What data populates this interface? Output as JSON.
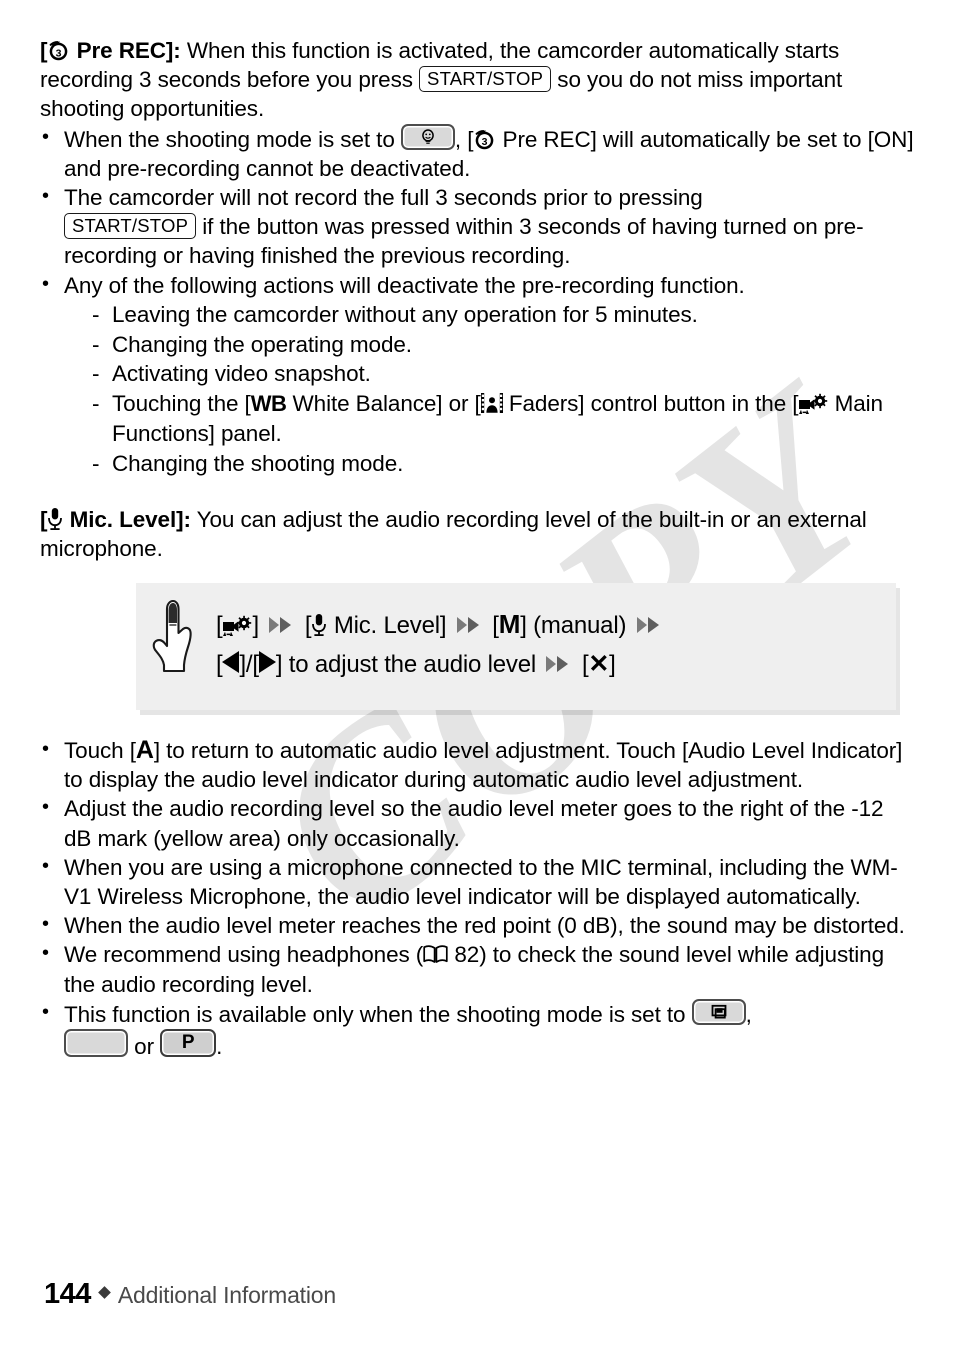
{
  "page": {
    "number": "144",
    "section": "Additional Information",
    "watermark": "COPY"
  },
  "prerec": {
    "icon": "pre-rec-icon",
    "label": "Pre REC",
    "bracket_open": "[",
    "bracket_close": "]:",
    "body_1": "When this function is activated, the camcorder automatically starts recording 3 seconds before you press",
    "key_start_stop": "START/STOP",
    "body_2": "so you do not miss important shooting opportunities.",
    "bullets": [
      {
        "t1": "When the shooting mode is set to",
        "chip": "smart-auto-mode-icon",
        "t2": ", [",
        "icon": "pre-rec-icon",
        "t3": "Pre REC] will automatically be set to [ON] and pre-recording cannot be deactivated."
      },
      {
        "t1": "The camcorder will not record the full 3 seconds prior to pressing",
        "key": "START/STOP",
        "t2": "if the button was pressed within 3 seconds of having turned on pre-recording or having finished the previous recording."
      },
      {
        "t1": "Any of the following actions will deactivate the pre-recording function."
      }
    ],
    "subitems": [
      {
        "text": "Leaving the camcorder without any operation for 5 minutes."
      },
      {
        "text": "Changing the operating mode."
      },
      {
        "text": "Activating video snapshot."
      },
      {
        "p1": "Touching the [",
        "wb": "WB",
        "p2": "White Balance] or [",
        "fader": "faders-icon",
        "p3": "Faders] control button in the [",
        "func": "main-functions-icon",
        "p4": "Main Functions] panel."
      },
      {
        "text": "Changing the shooting mode."
      }
    ]
  },
  "miclevel": {
    "icon": "microphone-icon",
    "label": "Mic. Level",
    "bracket_open": "[",
    "bracket_close": "]:",
    "body": "You can adjust the audio recording level of the built-in or an external microphone.",
    "procedure": {
      "hand_icon": "touch-hand-icon",
      "line1_a": "[",
      "line1_func_icon": "main-functions-icon",
      "line1_b": "]",
      "line1_c": "[",
      "line1_mic_icon": "microphone-icon",
      "line1_d": "Mic. Level]",
      "line1_e": "[",
      "line1_M": "M",
      "line1_f": "] (manual)",
      "line2_a": "[",
      "line2_left": "left-triangle-icon",
      "line2_b": "]/[",
      "line2_right": "right-triangle-icon",
      "line2_c": "] to adjust the audio level",
      "line2_d": "[",
      "line2_X": "✕",
      "line2_e": "]"
    },
    "bullets": [
      {
        "t1": "Touch [",
        "a": "A",
        "t2": "] to return to automatic audio level adjustment. Touch [Audio Level Indicator] to display the audio level indicator during automatic audio level adjustment."
      },
      {
        "t1": "Adjust the audio recording level so the audio level meter goes to the right of the -12 dB mark (yellow area) only occasionally."
      },
      {
        "t1": "When you are using a microphone connected to the MIC terminal, including the WM-V1 Wireless Microphone, the audio level indicator will be displayed automatically."
      },
      {
        "t1": "When the audio level meter reaches the red point (0 dB), the sound may be distorted."
      },
      {
        "t1": "We recommend using headphones (",
        "book": "open-book-icon",
        "page_ref": "82",
        "t2": ") to check the sound level while adjusting the audio recording level."
      },
      {
        "t1": "This function is available only when the shooting mode is set to",
        "chip1": "cinema-mode-icon",
        "t2": ",",
        "chip2": "blank-mode-icon",
        "t3": "or",
        "chip3": "P",
        "t4": "."
      }
    ]
  },
  "colors": {
    "text": "#000000",
    "box_bg": "#efefef",
    "watermark": "#e4e4e4",
    "chip_bg": "#d9d9d9",
    "footer_section": "#4a4a4a"
  }
}
